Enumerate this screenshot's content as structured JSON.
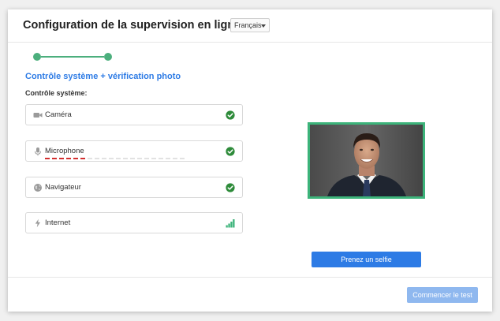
{
  "header": {
    "title": "Configuration de la supervision en ligne",
    "language": "Français"
  },
  "progress": {
    "current_step": 2,
    "total_steps": 2
  },
  "main": {
    "section_title": "Contrôle système + vérification photo",
    "subsection_label": "Contrôle système:",
    "checks": [
      {
        "label": "Caméra",
        "icon": "camera-icon",
        "status": "ok",
        "status_icon": "check-circle-icon"
      },
      {
        "label": "Microphone",
        "icon": "microphone-icon",
        "status": "ok",
        "status_icon": "check-circle-icon",
        "audio_level": 0.28
      },
      {
        "label": "Navigateur",
        "icon": "globe-icon",
        "status": "ok",
        "status_icon": "check-circle-icon"
      },
      {
        "label": "Internet",
        "icon": "lightning-icon",
        "status": "good",
        "status_icon": "signal-bars-icon"
      }
    ]
  },
  "photo": {
    "selfie_button": "Prenez un selfie"
  },
  "footer": {
    "start_button": "Commencer le test"
  },
  "colors": {
    "accent_blue": "#2d7be5",
    "success_green": "#3cb37a",
    "check_green": "#2e8b3a",
    "level_red": "#d32f2f",
    "disabled_blue": "#8fb8ef"
  }
}
